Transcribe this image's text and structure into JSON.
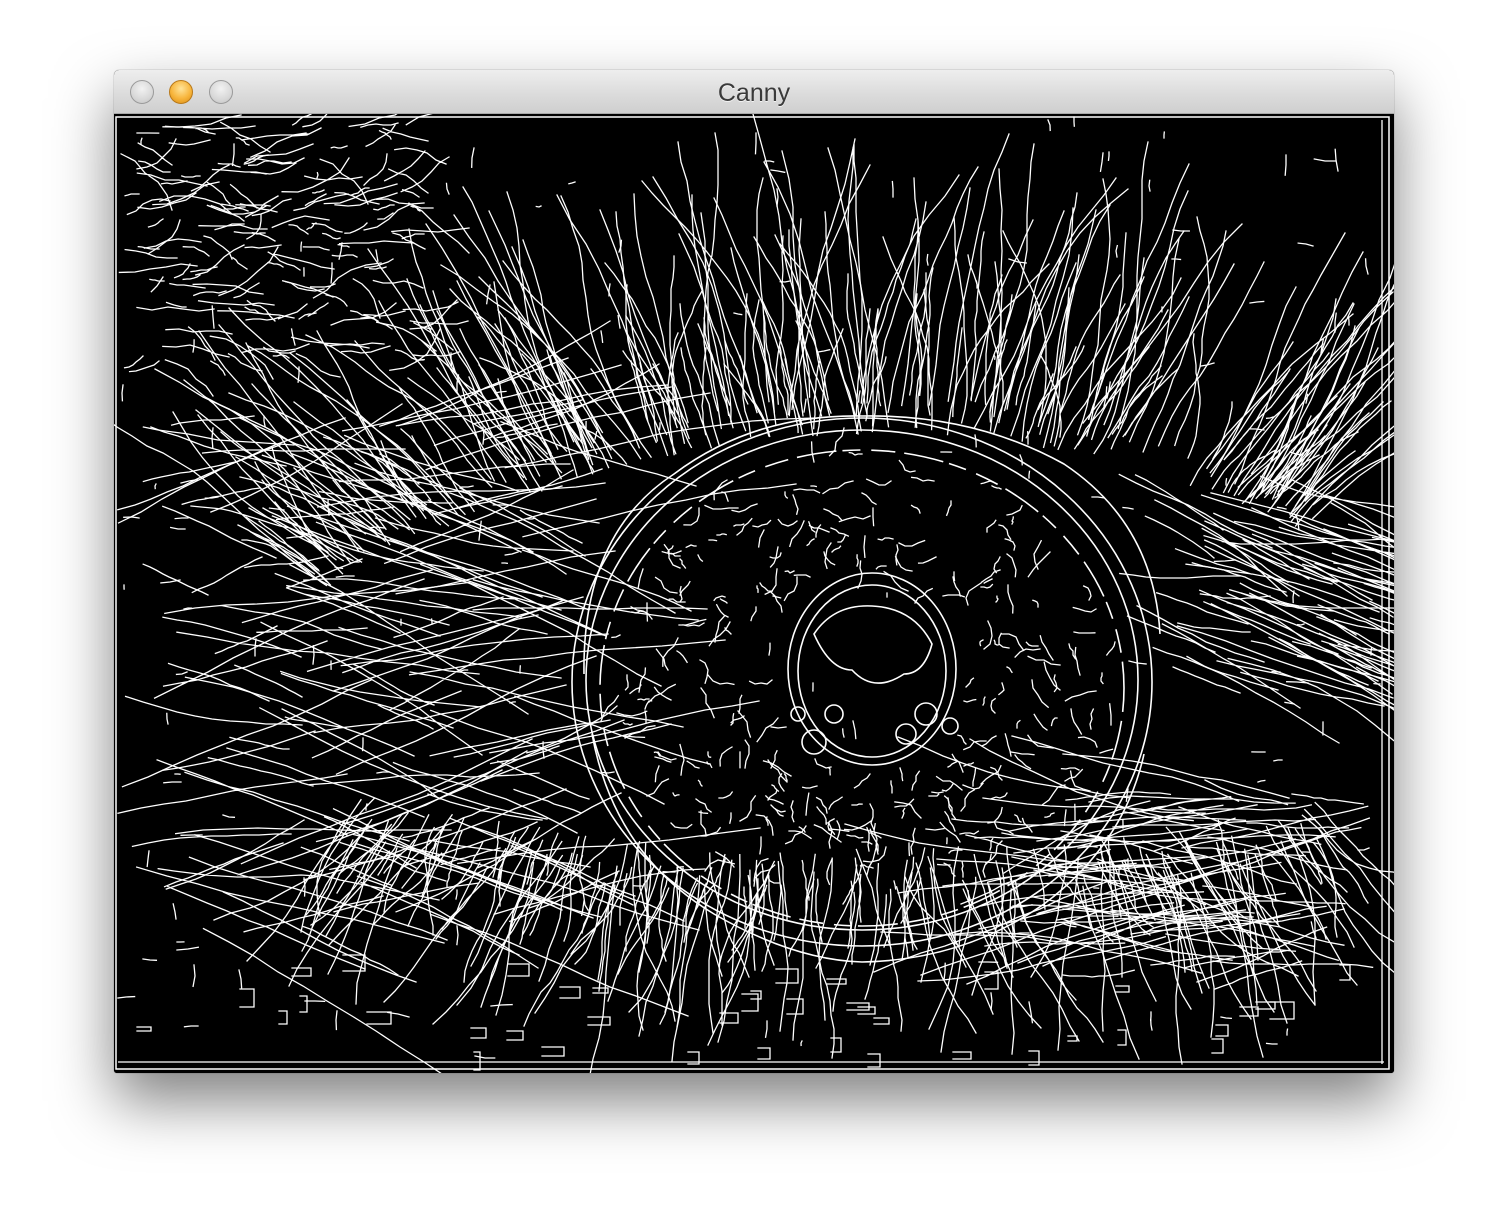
{
  "window": {
    "title": "Canny",
    "buttons": [
      "close-button",
      "minimize-button",
      "zoom-button"
    ],
    "colors": {
      "background": "#000000",
      "edges": "#ffffff",
      "minimize_accent": "#f7b53c"
    }
  },
  "image": {
    "kind": "canny-edge-map",
    "subject": "eye"
  }
}
